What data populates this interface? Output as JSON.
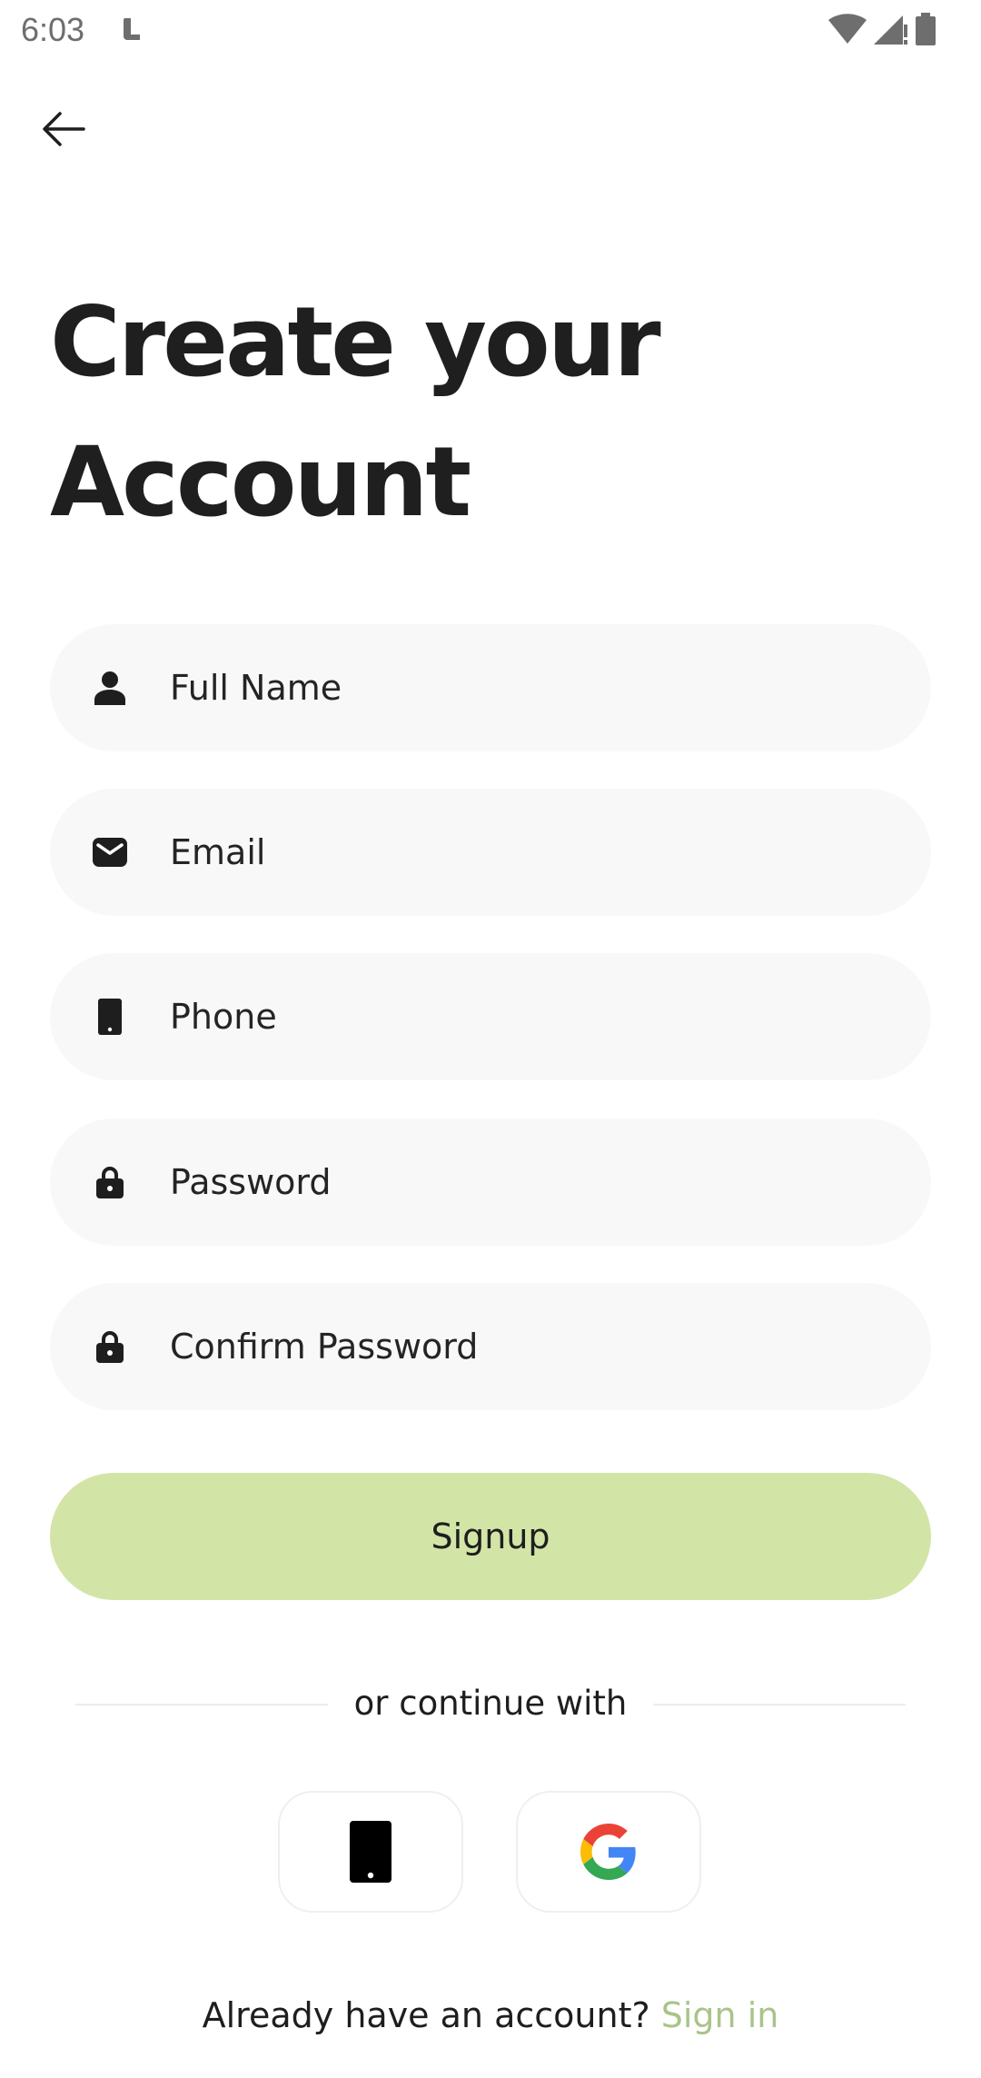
{
  "status_bar": {
    "time": "6:03"
  },
  "header": {
    "title_line1": "Create your",
    "title_line2": "Account"
  },
  "form": {
    "full_name": {
      "placeholder": "Full Name",
      "value": "",
      "icon": "person-icon"
    },
    "email": {
      "placeholder": "Email",
      "value": "",
      "icon": "mail-icon"
    },
    "phone": {
      "placeholder": "Phone",
      "value": "",
      "icon": "phone-icon"
    },
    "password": {
      "placeholder": "Password",
      "value": "",
      "icon": "lock-icon"
    },
    "confirm_password": {
      "placeholder": "Confirm Password",
      "value": "",
      "icon": "lock-icon"
    },
    "submit_label": "Signup"
  },
  "social": {
    "divider_text": "or continue with",
    "providers": [
      "phone-icon",
      "google-icon"
    ]
  },
  "footer": {
    "prompt": "Already have an account?",
    "link_label": "Sign in"
  },
  "colors": {
    "accent": "#d2e5a7",
    "link": "#a9c48a",
    "field_bg": "#f8f8f8",
    "text": "#1e1e1e"
  }
}
